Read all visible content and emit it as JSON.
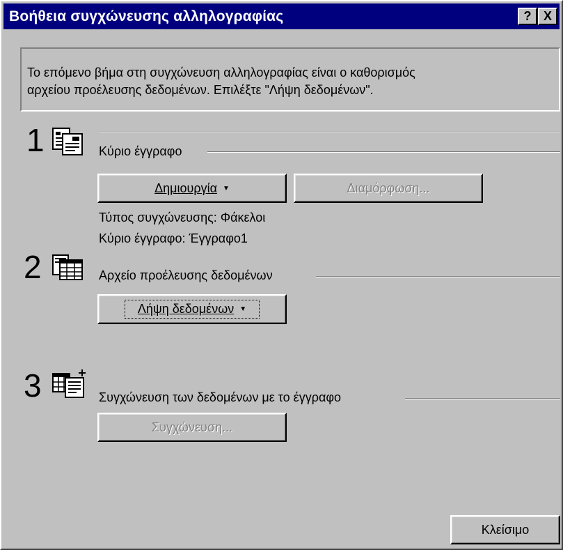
{
  "window": {
    "title": "Βοήθεια συγχώνευσης αλληλογραφίας",
    "help_label": "?",
    "close_label": "X"
  },
  "intro": {
    "line1": "Το επόμενο βήμα στη συγχώνευση αλληλογραφίας είναι ο καθορισμός",
    "line2": "αρχείου προέλευσης δεδομένων. Επιλέξτε \"Λήψη δεδομένων\"."
  },
  "steps": [
    {
      "number": "1",
      "icon": "main-document-icon",
      "label": "Κύριο έγγραφο",
      "create_button": "Δημιουργία",
      "edit_button": "Διαμόρφωση...",
      "merge_type": "Τύπος συγχώνευσης: Φάκελοι",
      "main_document": "Κύριο έγγραφο: Έγγραφο1"
    },
    {
      "number": "2",
      "icon": "data-source-icon",
      "label": "Αρχείο προέλευσης δεδομένων",
      "get_data_button": "Λήψη δεδομένων"
    },
    {
      "number": "3",
      "icon": "merge-data-icon",
      "label": "Συγχώνευση των δεδομένων με το έγγραφο",
      "merge_button": "Συγχώνευση..."
    }
  ],
  "footer": {
    "close_button": "Κλείσιμο"
  },
  "colors": {
    "titlebar": "#00007f",
    "face": "#c0c0c0",
    "disabled_text": "#808080"
  }
}
